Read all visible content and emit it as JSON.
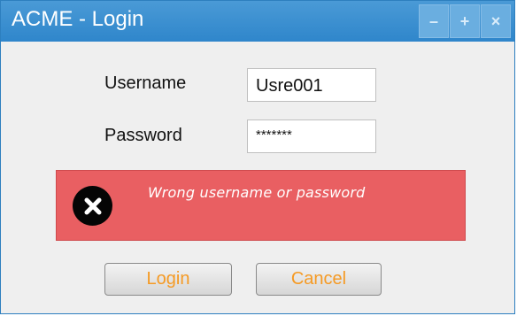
{
  "window": {
    "title": "ACME - Login",
    "controls": {
      "minimize_icon": "minimize-icon",
      "maximize_icon": "plus-icon",
      "close_icon": "close-icon"
    }
  },
  "form": {
    "username_label": "Username",
    "username_value": "Usre001",
    "password_label": "Password",
    "password_value": "*******"
  },
  "error": {
    "icon": "error-x-icon",
    "message": "Wrong username or password",
    "color": "#e95f62"
  },
  "actions": {
    "login_label": "Login",
    "cancel_label": "Cancel",
    "button_text_color": "#f59a24"
  },
  "colors": {
    "titlebar": "#2f86cb",
    "window_background": "#efefef"
  }
}
